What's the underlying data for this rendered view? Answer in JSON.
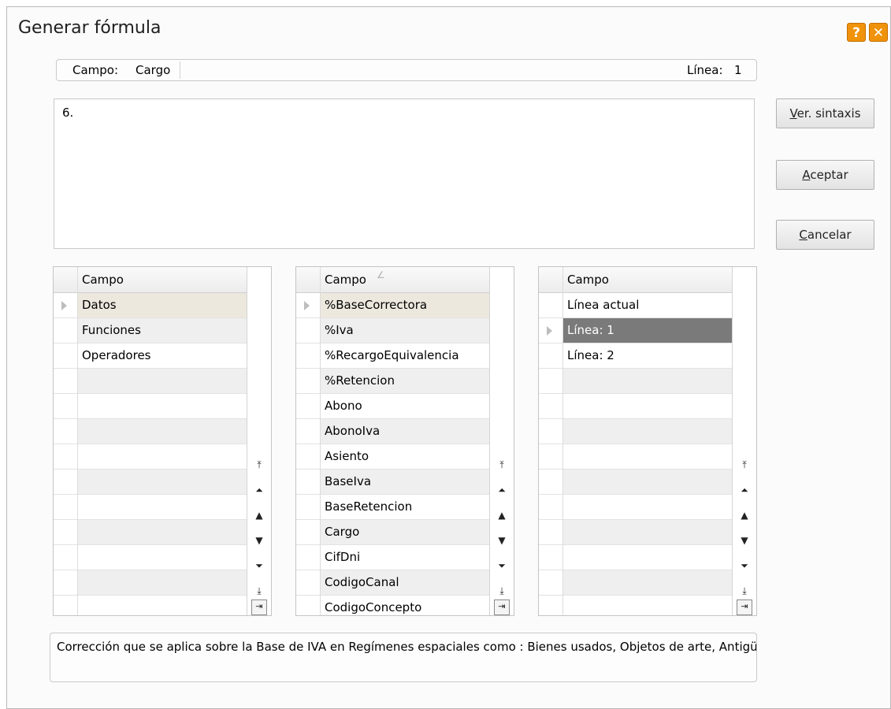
{
  "window": {
    "title": "Generar fórmula",
    "help_icon": "?",
    "close_icon": "✕"
  },
  "field_bar": {
    "campo_label": "Campo:",
    "campo_value": "Cargo",
    "linea_label": "Línea:",
    "linea_value": "1"
  },
  "formula": {
    "text": "6."
  },
  "buttons": {
    "ver_sintaxis": "Ver. sintaxis",
    "aceptar": "Aceptar",
    "cancelar": "Cancelar"
  },
  "grids": [
    {
      "header": "Campo",
      "rows": [
        "Datos",
        "Funciones",
        "Operadores",
        "",
        "",
        "",
        "",
        "",
        "",
        "",
        "",
        "",
        ""
      ],
      "current_row": 0,
      "selected_row": -1
    },
    {
      "header": "Campo",
      "rows": [
        "%BaseCorrectora",
        "%Iva",
        "%RecargoEquivalencia",
        "%Retencion",
        "Abono",
        "AbonoIva",
        "Asiento",
        "BaseIva",
        "BaseRetencion",
        "Cargo",
        "CifDni",
        "CodigoCanal",
        "CodigoConcepto"
      ],
      "current_row": 0,
      "selected_row": -1
    },
    {
      "header": "Campo",
      "rows": [
        "Línea actual",
        "Línea: 1",
        "Línea: 2",
        "",
        "",
        "",
        "",
        "",
        "",
        "",
        "",
        "",
        ""
      ],
      "current_row": -1,
      "selected_row": 1
    }
  ],
  "scroll_icons": [
    "⤒",
    "⏶",
    "▲",
    "▼",
    "⏷",
    "⤓",
    "⇥"
  ],
  "description": {
    "text": "Corrección que se aplica sobre la Base de IVA en Regímenes espaciales como : Bienes usados, Objetos de arte, Antigüedades y Ob"
  },
  "colors": {
    "accent": "#f0920a",
    "selected_row": "#7a7a7a",
    "current_row": "#ede8de"
  }
}
